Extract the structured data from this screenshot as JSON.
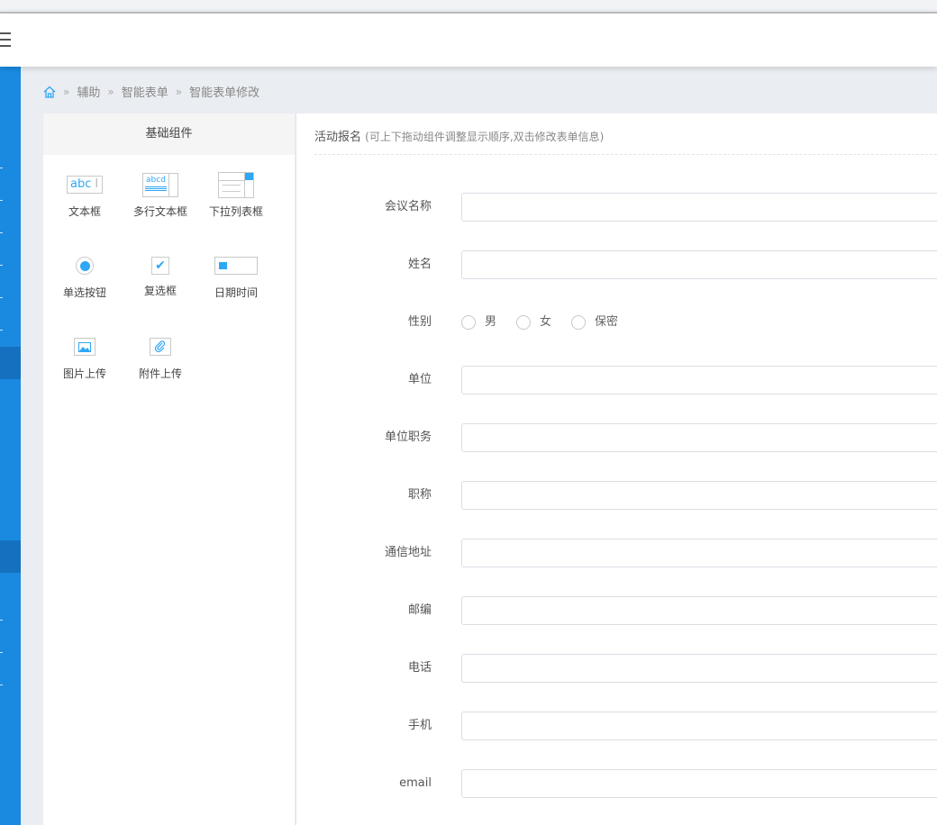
{
  "breadcrumb": {
    "items": [
      "辅助",
      "智能表单",
      "智能表单修改"
    ]
  },
  "components": {
    "title": "基础组件",
    "items": [
      {
        "label": "文本框",
        "icon": "textbox-icon",
        "icon_text": "abc"
      },
      {
        "label": "多行文本框",
        "icon": "textarea-icon",
        "icon_text": "abcd"
      },
      {
        "label": "下拉列表框",
        "icon": "select-icon"
      },
      {
        "label": "单选按钮",
        "icon": "radio-icon"
      },
      {
        "label": "复选框",
        "icon": "checkbox-icon"
      },
      {
        "label": "日期时间",
        "icon": "calendar-icon"
      },
      {
        "label": "图片上传",
        "icon": "image-icon"
      },
      {
        "label": "附件上传",
        "icon": "paperclip-icon"
      }
    ]
  },
  "form": {
    "title": "活动报名",
    "hint": "(可上下拖动组件调整显示顺序,双击修改表单信息)",
    "fields": [
      {
        "label": "会议名称",
        "value": ""
      },
      {
        "label": "姓名",
        "value": ""
      },
      {
        "label": "性别",
        "options": [
          "男",
          "女",
          "保密"
        ]
      },
      {
        "label": "单位",
        "value": ""
      },
      {
        "label": "单位职务",
        "value": ""
      },
      {
        "label": "职称",
        "value": ""
      },
      {
        "label": "通信地址",
        "value": ""
      },
      {
        "label": "邮编",
        "value": ""
      },
      {
        "label": "电话",
        "value": ""
      },
      {
        "label": "手机",
        "value": ""
      },
      {
        "label": "email",
        "value": ""
      }
    ]
  },
  "colors": {
    "accent": "#1a8ae0",
    "icon_blue": "#2ea7f5"
  }
}
